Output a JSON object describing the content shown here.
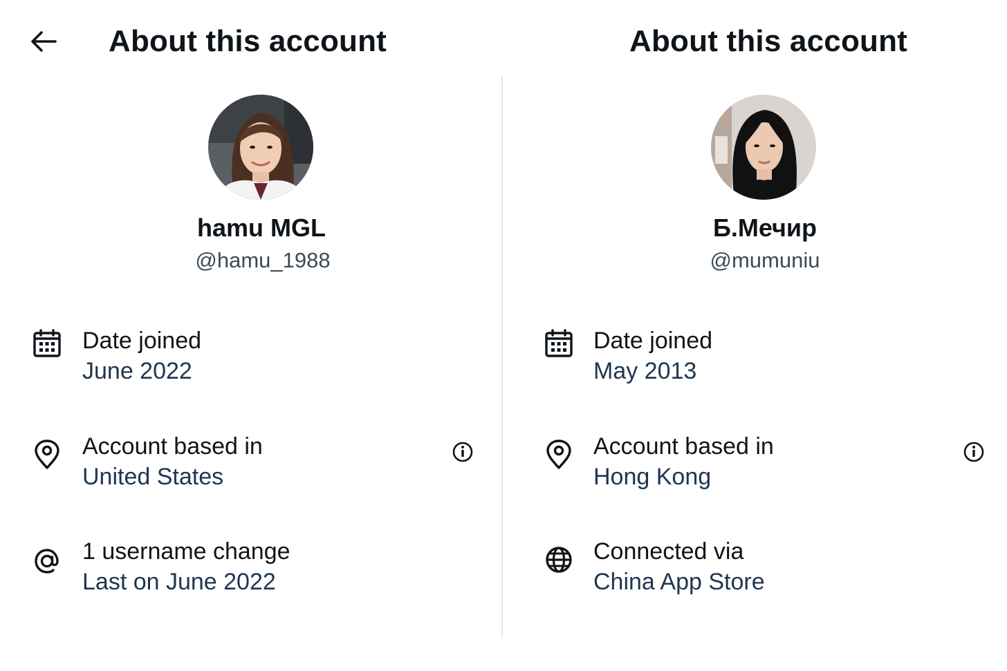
{
  "left": {
    "title": "About this account",
    "avatar_icon": "profile-photo",
    "name": "hamu MGL",
    "handle": "@hamu_1988",
    "rows": [
      {
        "icon": "calendar-icon",
        "label": "Date joined",
        "value": "June 2022"
      },
      {
        "icon": "location-pin-icon",
        "label": "Account based in",
        "value": "United States"
      },
      {
        "icon": "at-sign-icon",
        "label": "1 username change",
        "value": "Last on June 2022"
      }
    ]
  },
  "right": {
    "title": "About this account",
    "avatar_icon": "profile-photo",
    "name": "Б.Мечир",
    "handle": "@mumuniu",
    "rows": [
      {
        "icon": "calendar-icon",
        "label": "Date joined",
        "value": "May 2013"
      },
      {
        "icon": "location-pin-icon",
        "label": "Account based in",
        "value": "Hong Kong"
      },
      {
        "icon": "globe-icon",
        "label": "Connected via",
        "value": "China App Store"
      }
    ]
  },
  "colors": {
    "text_primary": "#0f1419",
    "text_value": "#1f3550",
    "divider": "#e3e6e8",
    "background": "#ffffff"
  }
}
